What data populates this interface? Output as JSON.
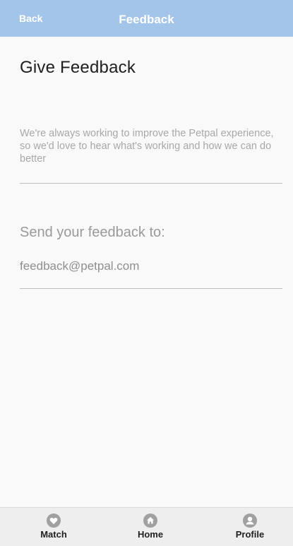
{
  "header": {
    "back_label": "Back",
    "title": "Feedback",
    "background_color": "#a4c5ea"
  },
  "main": {
    "page_title": "Give Feedback",
    "intro_text": "We're always working to improve the Petpal experience, so we'd love to hear what's working and how we can do better",
    "send_label": "Send your feedback to:",
    "email": "feedback@petpal.com"
  },
  "tabbar": {
    "tabs": [
      {
        "label": "Match",
        "icon": "heart-icon"
      },
      {
        "label": "Home",
        "icon": "home-icon"
      },
      {
        "label": "Profile",
        "icon": "user-icon"
      }
    ]
  }
}
